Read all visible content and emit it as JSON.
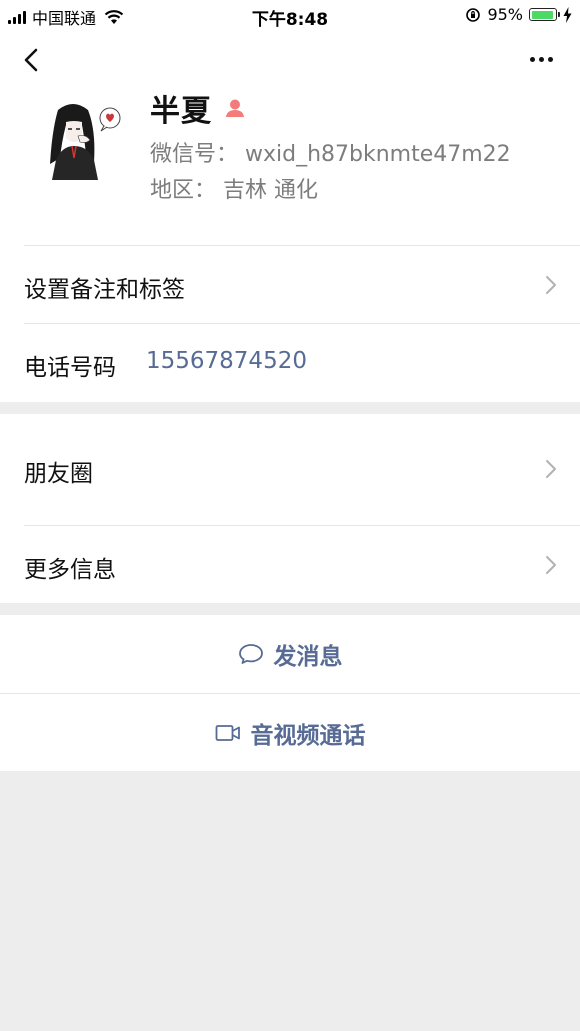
{
  "status_bar": {
    "carrier": "中国联通",
    "time": "下午8:48",
    "battery_percent": "95%",
    "battery_level": 0.95
  },
  "profile": {
    "name": "半夏",
    "wxid": "微信号：  wxid_h87bknmte47m22",
    "region": "地区：  吉林  通化"
  },
  "rows": {
    "remark_label": "设置备注和标签",
    "phone_label": "电话号码",
    "phone_value": "15567874520",
    "moments_label": "朋友圈",
    "more_info_label": "更多信息"
  },
  "actions": {
    "message_label": "发消息",
    "video_call_label": "音视频通话"
  },
  "colors": {
    "link": "#576b95",
    "gender_female": "#f37b7b",
    "battery_green": "#4cd964"
  }
}
